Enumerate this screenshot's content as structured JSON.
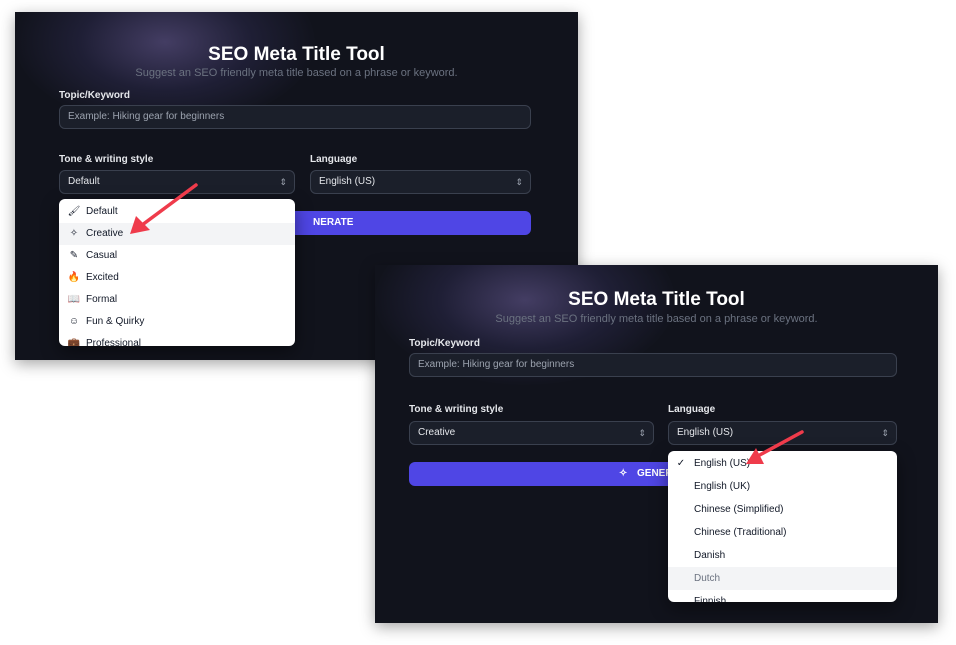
{
  "app": {
    "title": "SEO Meta Title Tool",
    "subtitle": "Suggest an SEO friendly meta title based on a phrase or keyword."
  },
  "topic": {
    "label": "Topic/Keyword",
    "placeholder": "Example: Hiking gear for beginners"
  },
  "tone": {
    "label": "Tone & writing style"
  },
  "language": {
    "label": "Language"
  },
  "screen1": {
    "tone_value": "Default",
    "language_value": "English (US)",
    "button_partial": "NERATE",
    "tone_options": [
      {
        "label": "Default",
        "icon": "brush-icon"
      },
      {
        "label": "Creative",
        "icon": "sparkles-icon"
      },
      {
        "label": "Casual",
        "icon": "pencil-icon"
      },
      {
        "label": "Excited",
        "icon": "flame-icon"
      },
      {
        "label": "Formal",
        "icon": "book-icon"
      },
      {
        "label": "Fun & Quirky",
        "icon": "smile-icon"
      },
      {
        "label": "Professional",
        "icon": "briefcase-icon"
      }
    ]
  },
  "screen2": {
    "tone_value": "Creative",
    "language_value": "English (US)",
    "button_partial": "GENER",
    "language_options": [
      "English (US)",
      "English (UK)",
      "Chinese (Simplified)",
      "Chinese (Traditional)",
      "Danish",
      "Dutch",
      "Finnish"
    ]
  },
  "colors": {
    "accent": "#4f46e5",
    "panel": "#11131c",
    "arrow": "#ef3b4b"
  }
}
